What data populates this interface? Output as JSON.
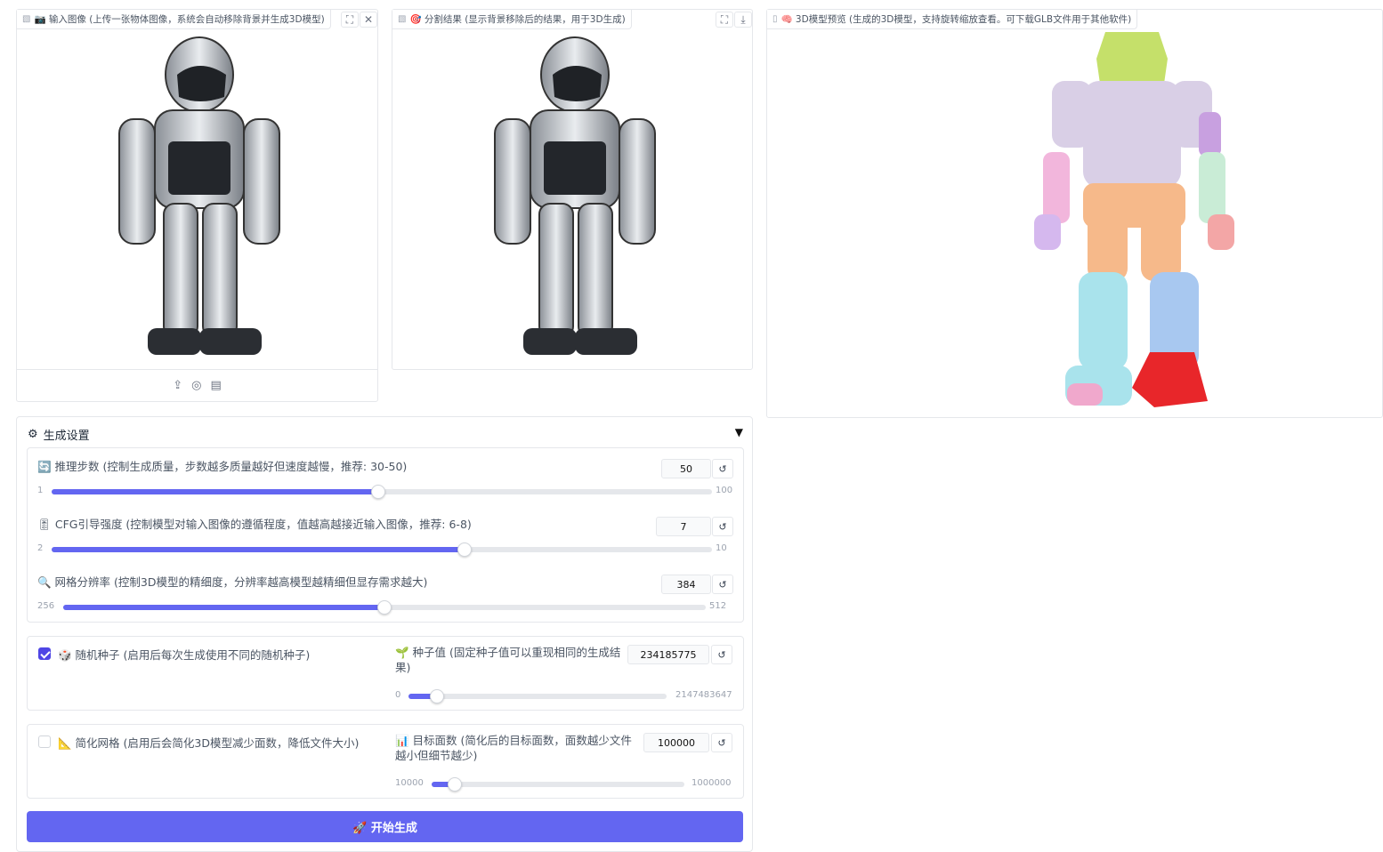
{
  "input_panel": {
    "icon": "camera-icon",
    "title": "📷 输入图像 (上传一张物体图像，系统会自动移除背景并生成3D模型)"
  },
  "seg_panel": {
    "icon": "target-icon",
    "title": "🎯 分割结果 (显示背景移除后的结果，用于3D生成)"
  },
  "model_panel": {
    "icon": "brain-icon",
    "title": "🧠 3D模型预览 (生成的3D模型，支持旋转缩放查看。可下载GLB文件用于其他软件)"
  },
  "settings": {
    "icon": "gear-icon",
    "title": "生成设置",
    "collapse": "▼"
  },
  "sliders": [
    {
      "label": "🔄 推理步数 (控制生成质量，步数越多质量越好但速度越慢，推荐: 30-50)",
      "value": "50",
      "min": "1",
      "max": "100",
      "frac": 0.495
    },
    {
      "label": "🎚 CFG引导强度 (控制模型对输入图像的遵循程度，值越高越接近输入图像，推荐: 6-8)",
      "value": "7",
      "min": "2",
      "max": "10",
      "frac": 0.625
    },
    {
      "label": "🔍 网格分辨率 (控制3D模型的精细度，分辨率越高模型越精细但显存需求越大)",
      "value": "384",
      "min": "256",
      "max": "512",
      "frac": 0.5
    }
  ],
  "seed_row": {
    "checkbox_label": "🎲 随机种子 (启用后每次生成使用不同的随机种子)",
    "checked": true,
    "field_label": "🌱 种子值 (固定种子值可以重现相同的生成结果)",
    "value": "234185775",
    "min": "0",
    "max": "2147483647",
    "frac": 0.109
  },
  "simplify_row": {
    "checkbox_label": "📐 简化网格 (启用后会简化3D模型减少面数，降低文件大小)",
    "checked": false,
    "field_label": "📊 目标面数 (简化后的目标面数，面数越少文件越小但细节越少)",
    "value": "100000",
    "min": "10000",
    "max": "1000000",
    "frac": 0.091
  },
  "generate_button": "🚀 开始生成",
  "colors": {
    "accent": "#6366f1"
  }
}
